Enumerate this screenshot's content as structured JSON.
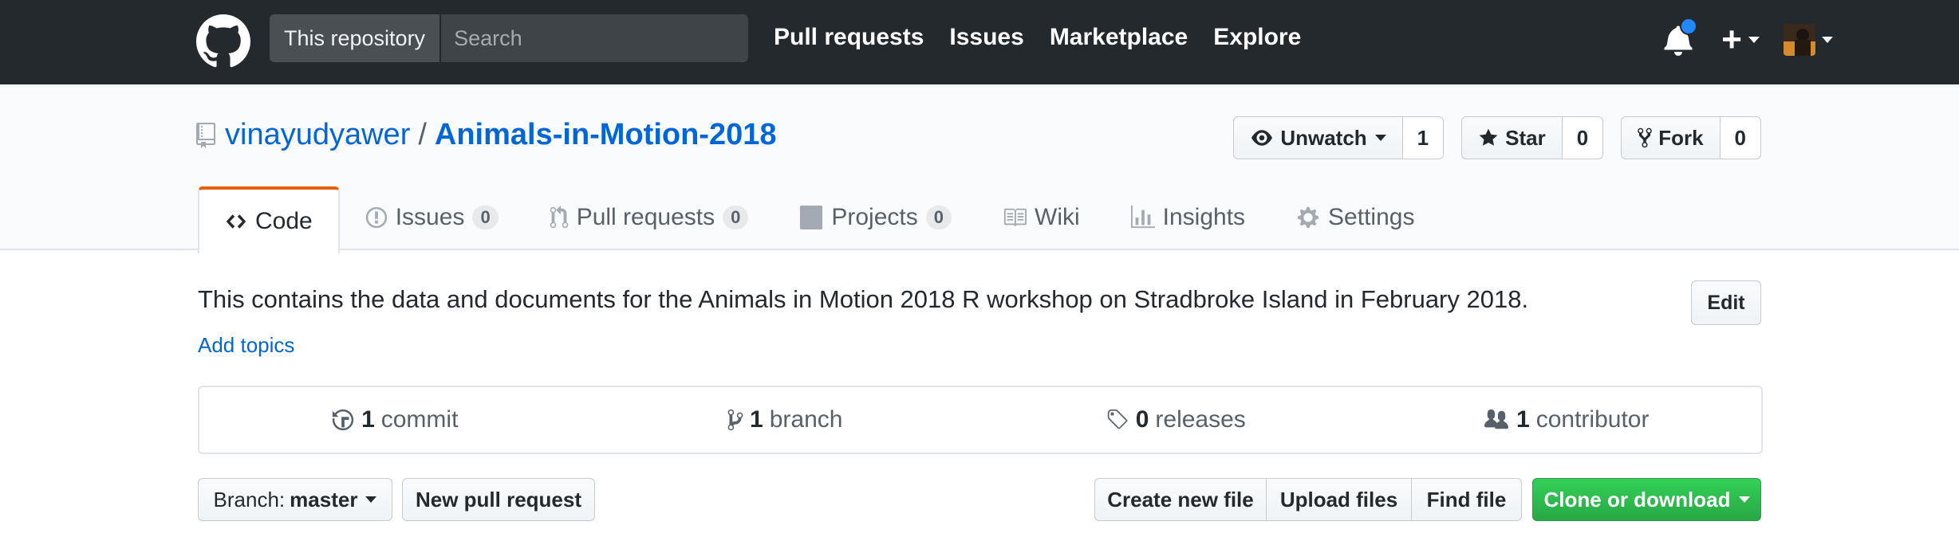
{
  "header": {
    "search_scope": "This repository",
    "search_placeholder": "Search",
    "nav": [
      "Pull requests",
      "Issues",
      "Marketplace",
      "Explore"
    ],
    "plus_symbol": "+",
    "icons": [
      "github-logo-icon",
      "bell-icon",
      "plus-icon",
      "avatar"
    ]
  },
  "repo": {
    "owner": "vinayudyawer",
    "separator": "/",
    "name": "Animals-in-Motion-2018",
    "watch_label": "Unwatch",
    "watch_count": "1",
    "star_label": "Star",
    "star_count": "0",
    "fork_label": "Fork",
    "fork_count": "0"
  },
  "tabs": [
    {
      "label": "Code",
      "counter": null,
      "selected": true
    },
    {
      "label": "Issues",
      "counter": "0"
    },
    {
      "label": "Pull requests",
      "counter": "0"
    },
    {
      "label": "Projects",
      "counter": "0"
    },
    {
      "label": "Wiki",
      "counter": null
    },
    {
      "label": "Insights",
      "counter": null
    },
    {
      "label": "Settings",
      "counter": null
    }
  ],
  "description": "This contains the data and documents for the Animals in Motion 2018 R workshop on Stradbroke Island in February 2018.",
  "edit_label": "Edit",
  "add_topics": "Add topics",
  "summary": {
    "commits_num": "1",
    "commits_label": "commit",
    "branches_num": "1",
    "branches_label": "branch",
    "releases_num": "0",
    "releases_label": "releases",
    "contributors_num": "1",
    "contributors_label": "contributor"
  },
  "filebar": {
    "branch_prefix": "Branch:",
    "branch_name": "master",
    "new_pr": "New pull request",
    "create_file": "Create new file",
    "upload_files": "Upload files",
    "find_file": "Find file",
    "clone": "Clone or download"
  },
  "colors": {
    "header_bg": "#24292e",
    "link": "#0366d6",
    "accent_tab": "#e36209",
    "clone_green": "#28a745",
    "notification_dot": "#2188ff"
  }
}
